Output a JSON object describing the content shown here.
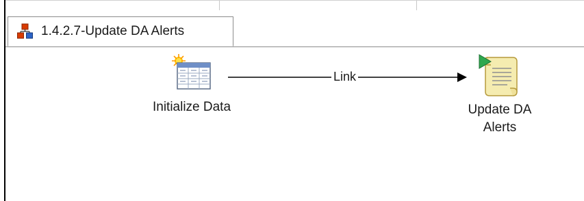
{
  "tab": {
    "title": "1.4.2.7-Update DA Alerts",
    "icon": "workflow-icon"
  },
  "workflow": {
    "nodes": [
      {
        "id": "initialize",
        "label": "Initialize Data",
        "icon": "table-icon"
      },
      {
        "id": "update",
        "label_line1": "Update DA",
        "label_line2": "Alerts",
        "icon": "script-scroll-icon"
      }
    ],
    "link": {
      "label": "Link",
      "from": "initialize",
      "to": "update"
    }
  },
  "colors": {
    "link_line": "#000000",
    "tab_border": "#8c8c8c",
    "icon_red": "#d83b01",
    "icon_blue": "#2b63c6",
    "start_arrow_green": "#2fa84f",
    "scroll_yellow": "#f5ecb0"
  }
}
